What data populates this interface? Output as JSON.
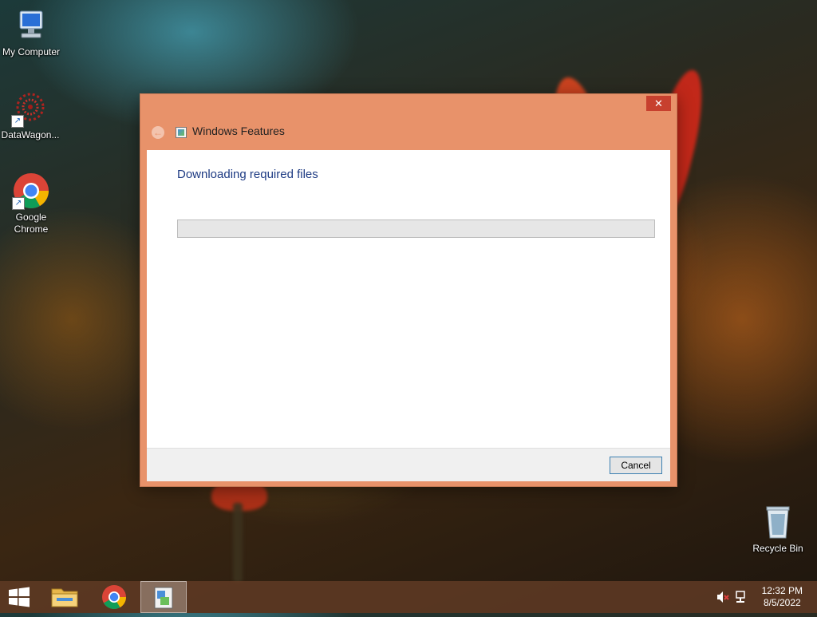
{
  "desktop": {
    "icons": [
      {
        "label": "My Computer"
      },
      {
        "label": "DataWagon..."
      },
      {
        "label": "Google Chrome"
      },
      {
        "label": "Recycle Bin"
      }
    ]
  },
  "dialog": {
    "title": "Windows Features",
    "close_label": "✕",
    "back_label": "←",
    "heading": "Downloading required files",
    "progress": 0,
    "cancel_label": "Cancel"
  },
  "taskbar": {
    "time": "12:32 PM",
    "date": "8/5/2022"
  },
  "colors": {
    "titlebar": "#e8926a",
    "close": "#c7402e",
    "heading": "#1e3b83",
    "taskbar": "#5f3a24"
  }
}
